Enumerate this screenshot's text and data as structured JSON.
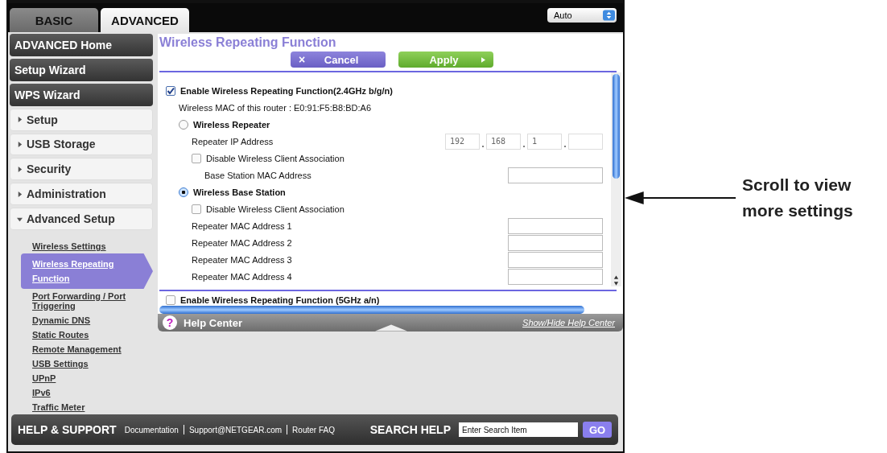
{
  "tabs": [
    {
      "label": "BASIC",
      "selected": false
    },
    {
      "label": "ADVANCED",
      "selected": true
    }
  ],
  "language_select": {
    "value": "Auto"
  },
  "sidebar": {
    "items": [
      {
        "kind": "button",
        "label": "ADVANCED Home"
      },
      {
        "kind": "button",
        "label": "Setup Wizard"
      },
      {
        "kind": "button",
        "label": "WPS Wizard"
      },
      {
        "kind": "section",
        "label": "Setup",
        "expanded": false
      },
      {
        "kind": "section",
        "label": "USB Storage",
        "expanded": false
      },
      {
        "kind": "section",
        "label": "Security",
        "expanded": false
      },
      {
        "kind": "section",
        "label": "Administration",
        "expanded": false
      },
      {
        "kind": "section",
        "label": "Advanced Setup",
        "expanded": true,
        "children": [
          {
            "label": "Wireless Settings",
            "selected": false
          },
          {
            "label": "Wireless Repeating Function",
            "selected": true
          },
          {
            "label": "Port Forwarding / Port Triggering",
            "selected": false
          },
          {
            "label": "Dynamic DNS",
            "selected": false
          },
          {
            "label": "Static Routes",
            "selected": false
          },
          {
            "label": "Remote Management",
            "selected": false
          },
          {
            "label": "USB Settings",
            "selected": false
          },
          {
            "label": "UPnP",
            "selected": false
          },
          {
            "label": "IPv6",
            "selected": false
          },
          {
            "label": "Traffic Meter",
            "selected": false
          }
        ]
      }
    ]
  },
  "page": {
    "title": "Wireless Repeating Function",
    "cancel": "Cancel",
    "cancel_icon": "×",
    "apply": "Apply"
  },
  "settings": [
    {
      "kind": "checkbox",
      "label": "Enable Wireless Repeating Function(2.4GHz b/g/n)",
      "checked": true,
      "children": [
        {
          "kind": "text",
          "text": "Wireless MAC of this router : E0:91:F5:B8:BD:A6"
        },
        {
          "kind": "radio",
          "label": "Wireless Repeater",
          "selected": false,
          "children": [
            {
              "kind": "ip",
              "label": "Repeater IP Address",
              "octets": [
                "192",
                "168",
                "1"
              ]
            },
            {
              "kind": "checkbox",
              "label": "Disable Wireless Client Association",
              "checked": false,
              "children": [
                {
                  "kind": "field",
                  "label": "Base Station MAC Address"
                }
              ]
            }
          ]
        },
        {
          "kind": "radio",
          "label": "Wireless Base Station",
          "selected": true,
          "children": [
            {
              "kind": "checkbox",
              "label": "Disable Wireless Client Association",
              "checked": false
            },
            {
              "kind": "field",
              "label": "Repeater MAC Address 1"
            },
            {
              "kind": "field",
              "label": "Repeater MAC Address 2"
            },
            {
              "kind": "field",
              "label": "Repeater MAC Address 3"
            },
            {
              "kind": "field",
              "label": "Repeater MAC Address 4"
            }
          ]
        }
      ]
    }
  ],
  "next_section": {
    "label": "Enable Wireless Repeating Function (5GHz a/n)",
    "checked": false
  },
  "help_center": {
    "icon": "?",
    "title": "Help Center",
    "toggle": "Show/Hide Help Center"
  },
  "footer": {
    "title": "HELP & SUPPORT",
    "links": [
      "Documentation",
      "Support@NETGEAR.com",
      "Router FAQ"
    ],
    "search_label": "SEARCH HELP",
    "search_placeholder": "Enter Search Item",
    "go": "GO"
  },
  "callout": {
    "text": "Scroll to view more settings"
  }
}
